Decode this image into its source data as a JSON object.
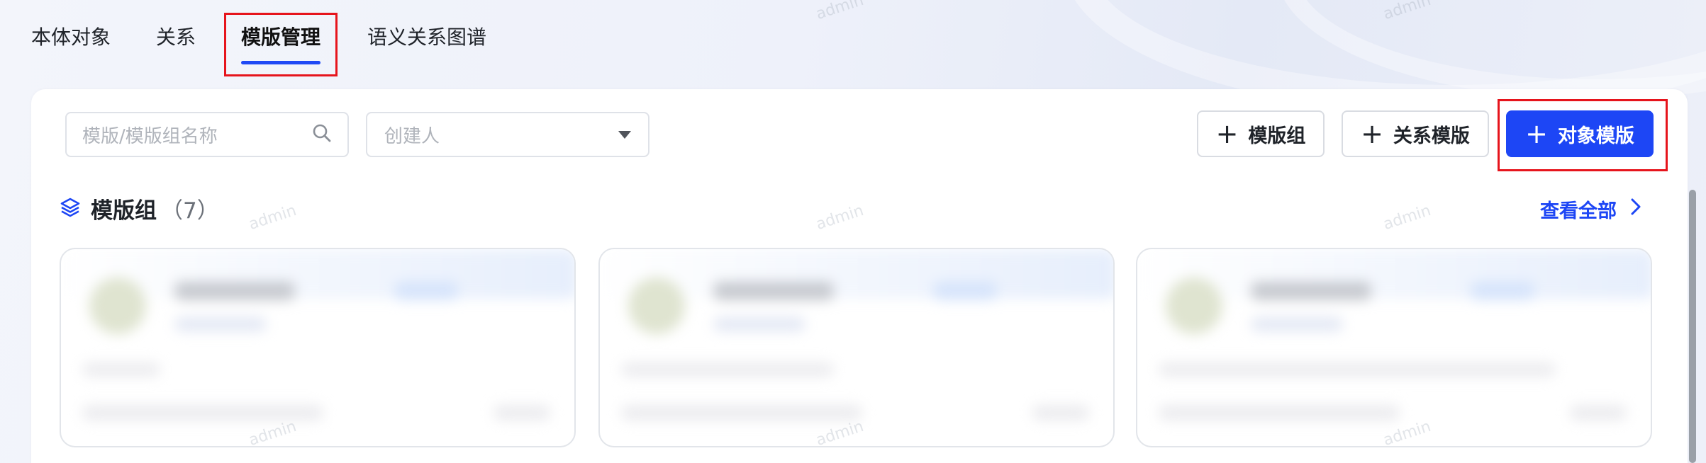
{
  "tabs": [
    {
      "label": "本体对象",
      "active": false
    },
    {
      "label": "关系",
      "active": false
    },
    {
      "label": "模版管理",
      "active": true
    },
    {
      "label": "语义关系图谱",
      "active": false
    }
  ],
  "toolbar": {
    "search_placeholder": "模版/模版组名称",
    "creator_placeholder": "创建人",
    "add_group_label": "模版组",
    "add_relation_template_label": "关系模版",
    "add_object_template_label": "对象模版"
  },
  "section": {
    "title": "模版组",
    "count": "（7）",
    "view_all_label": "查看全部"
  },
  "watermark_text": "admin",
  "colors": {
    "accent": "#1d46f5",
    "highlight_box": "#e6141c"
  },
  "icons": {
    "search": "search-icon",
    "dropdown": "caret-down-icon",
    "plus": "plus-icon",
    "layers": "layers-icon",
    "chevron": "chevron-right-icon"
  }
}
